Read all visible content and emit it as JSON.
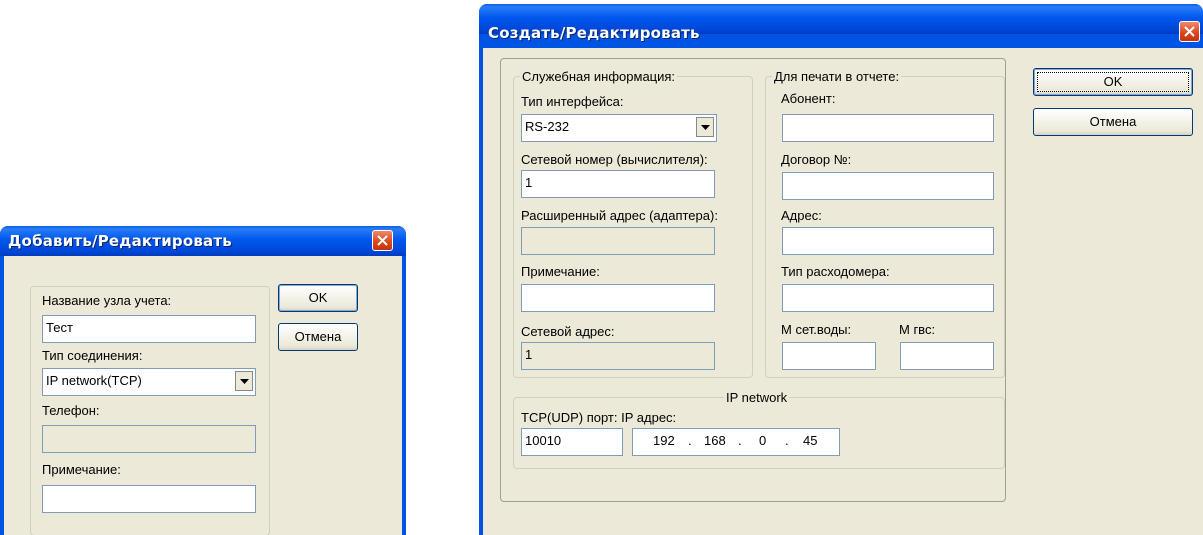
{
  "dialog_add": {
    "title": "Добавить/Редактировать",
    "node_name_label": "Название узла учета:",
    "node_name_value": "Тест",
    "connection_type_label": "Тип соединения:",
    "connection_type_value": "IP network(TCP)",
    "phone_label": "Телефон:",
    "phone_value": "",
    "note_label": "Примечание:",
    "note_value": "",
    "ok_label": "OK",
    "cancel_label": "Отмена"
  },
  "dialog_create": {
    "title": "Создать/Редактировать",
    "service_group": {
      "legend": "Служебная информация:",
      "interface_type_label": "Тип интерфейса:",
      "interface_type_value": "RS-232",
      "network_number_label": "Сетевой номер (вычислителя):",
      "network_number_value": "1",
      "extended_address_label": "Расширенный адрес (адаптера):",
      "extended_address_value": "",
      "note_label": "Примечание:",
      "note_value": "",
      "network_address_label": "Сетевой адрес:",
      "network_address_value": "1"
    },
    "print_group": {
      "legend": "Для печати в отчете:",
      "subscriber_label": "Абонент:",
      "subscriber_value": "",
      "contract_label": "Договор №:",
      "contract_value": "",
      "address_label": "Адрес:",
      "address_value": "",
      "flowmeter_type_label": "Тип расходомера:",
      "flowmeter_type_value": "",
      "m_network_water_label": "М сет.воды:",
      "m_network_water_value": "",
      "m_hot_water_label": "М гвс:",
      "m_hot_water_value": ""
    },
    "ip_group": {
      "legend": "IP network",
      "port_ip_label": "TCP(UDP) порт: IP адрес:",
      "port_value": "10010",
      "ip_octets": [
        "192",
        "168",
        "0",
        "45"
      ]
    },
    "ok_label": "OK",
    "cancel_label": "Отмена"
  }
}
